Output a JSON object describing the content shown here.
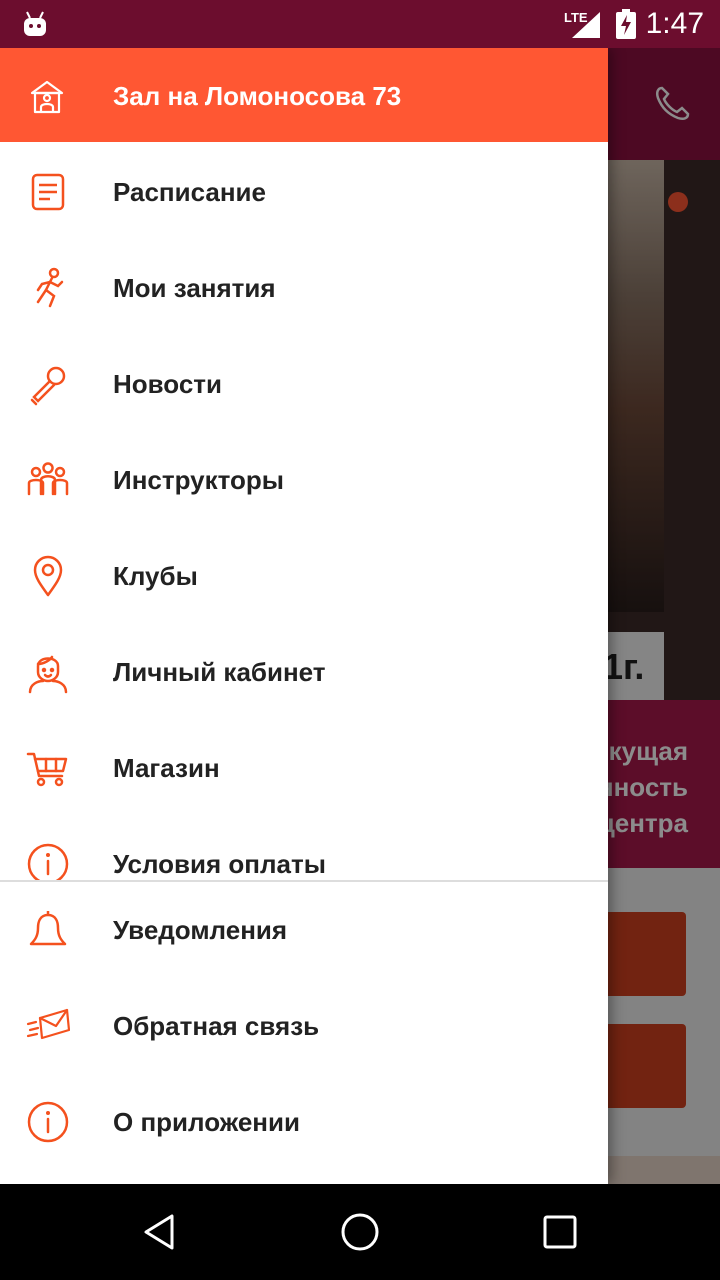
{
  "status_bar": {
    "network": "LTE",
    "time": "1:47"
  },
  "background": {
    "year_badge": "1г.",
    "promo_lines": [
      "кущая",
      "нность",
      "центра"
    ]
  },
  "drawer": {
    "header": {
      "title": "Зал на Ломоносова 73",
      "background_color": "#ff5733",
      "icon": "house-icon"
    },
    "menu_items": [
      {
        "label": "Расписание",
        "icon": "document-icon"
      },
      {
        "label": "Мои занятия",
        "icon": "runner-icon"
      },
      {
        "label": "Новости",
        "icon": "microphone-icon"
      },
      {
        "label": "Инструкторы",
        "icon": "people-icon"
      },
      {
        "label": "Клубы",
        "icon": "location-pin-icon"
      },
      {
        "label": "Личный кабинет",
        "icon": "person-icon"
      },
      {
        "label": "Магазин",
        "icon": "cart-icon"
      },
      {
        "label": "Условия оплаты",
        "icon": "info-icon"
      }
    ],
    "bottom_items": [
      {
        "label": "Уведомления",
        "icon": "bell-icon"
      },
      {
        "label": "Обратная связь",
        "icon": "envelope-icon"
      },
      {
        "label": "О приложении",
        "icon": "info-icon"
      }
    ],
    "accent_color": "#f4511e"
  },
  "colors": {
    "status_bar": "#6c0d2e",
    "toolbar": "#8c1240",
    "accent": "#ff5733",
    "icon": "#f4511e"
  }
}
